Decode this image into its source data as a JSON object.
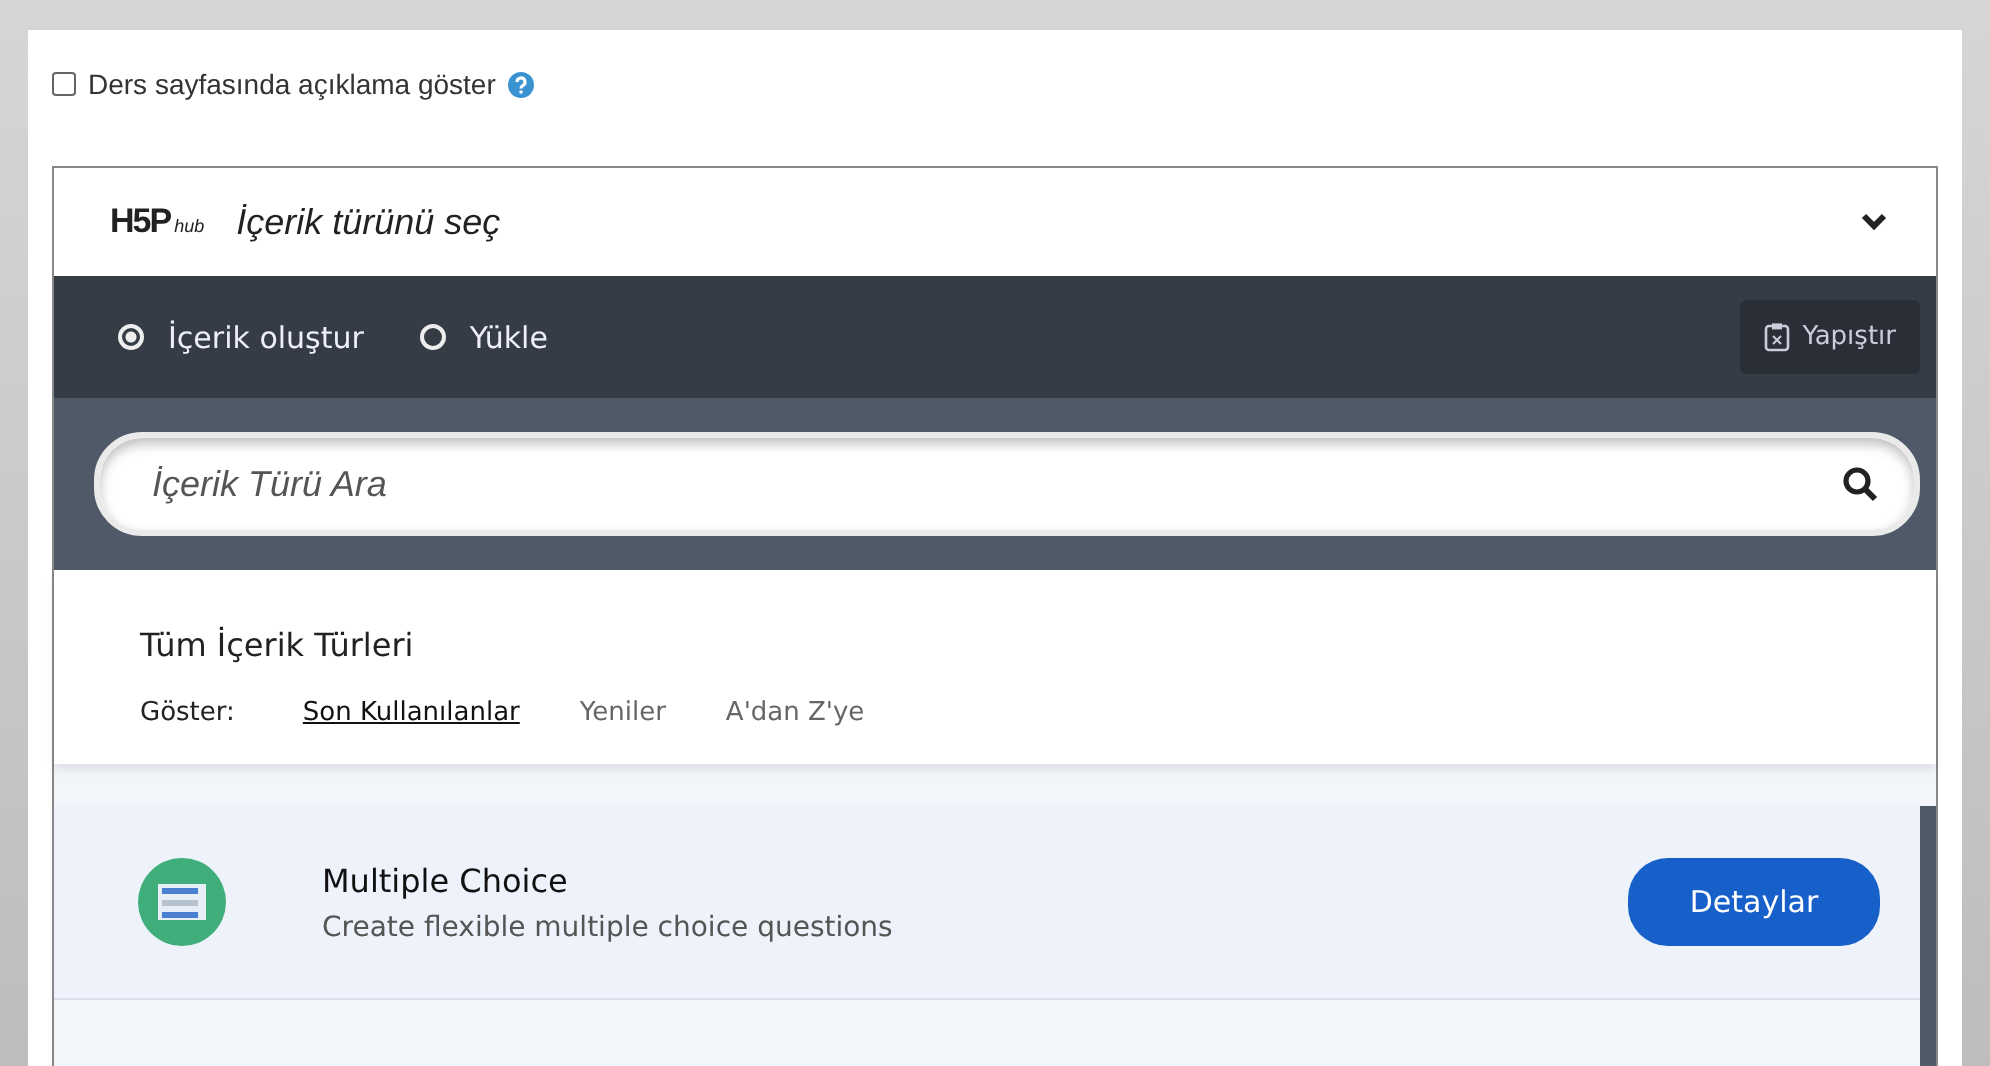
{
  "option": {
    "label": "Ders sayfasında açıklama göster",
    "checked": false
  },
  "hub": {
    "logo": {
      "mark": "H5P",
      "sub": "hub"
    },
    "title": "İçerik türünü seç",
    "modes": [
      {
        "label": "İçerik oluştur",
        "selected": true
      },
      {
        "label": "Yükle",
        "selected": false
      }
    ],
    "paste": "Yapıştır",
    "search": {
      "placeholder": "İçerik Türü Ara"
    },
    "section_title": "Tüm İçerik Türleri",
    "filter_label": "Göster:",
    "filters": [
      {
        "label": "Son Kullanılanlar",
        "selected": true
      },
      {
        "label": "Yeniler",
        "selected": false
      },
      {
        "label": "A'dan Z'ye",
        "selected": false
      }
    ],
    "items": [
      {
        "title": "Multiple Choice",
        "description": "Create flexible multiple choice questions",
        "button": "Detaylar"
      }
    ]
  }
}
